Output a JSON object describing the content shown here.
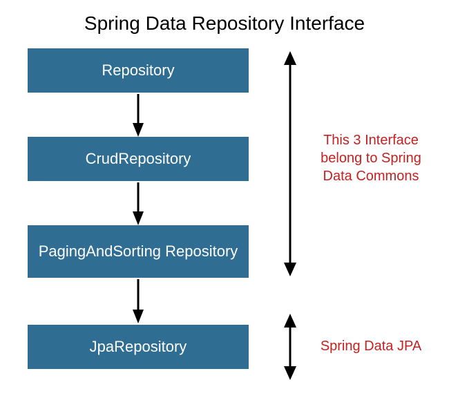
{
  "title": "Spring Data Repository Interface",
  "boxes": {
    "b1": "Repository",
    "b2": "CrudRepository",
    "b3": "PagingAndSorting Repository",
    "b4": "JpaRepository"
  },
  "notes": {
    "n1": "This 3 Interface belong to Spring Data Commons",
    "n2": "Spring Data JPA"
  },
  "colors": {
    "box_bg": "#2f6d93",
    "note_text": "#c62020"
  }
}
